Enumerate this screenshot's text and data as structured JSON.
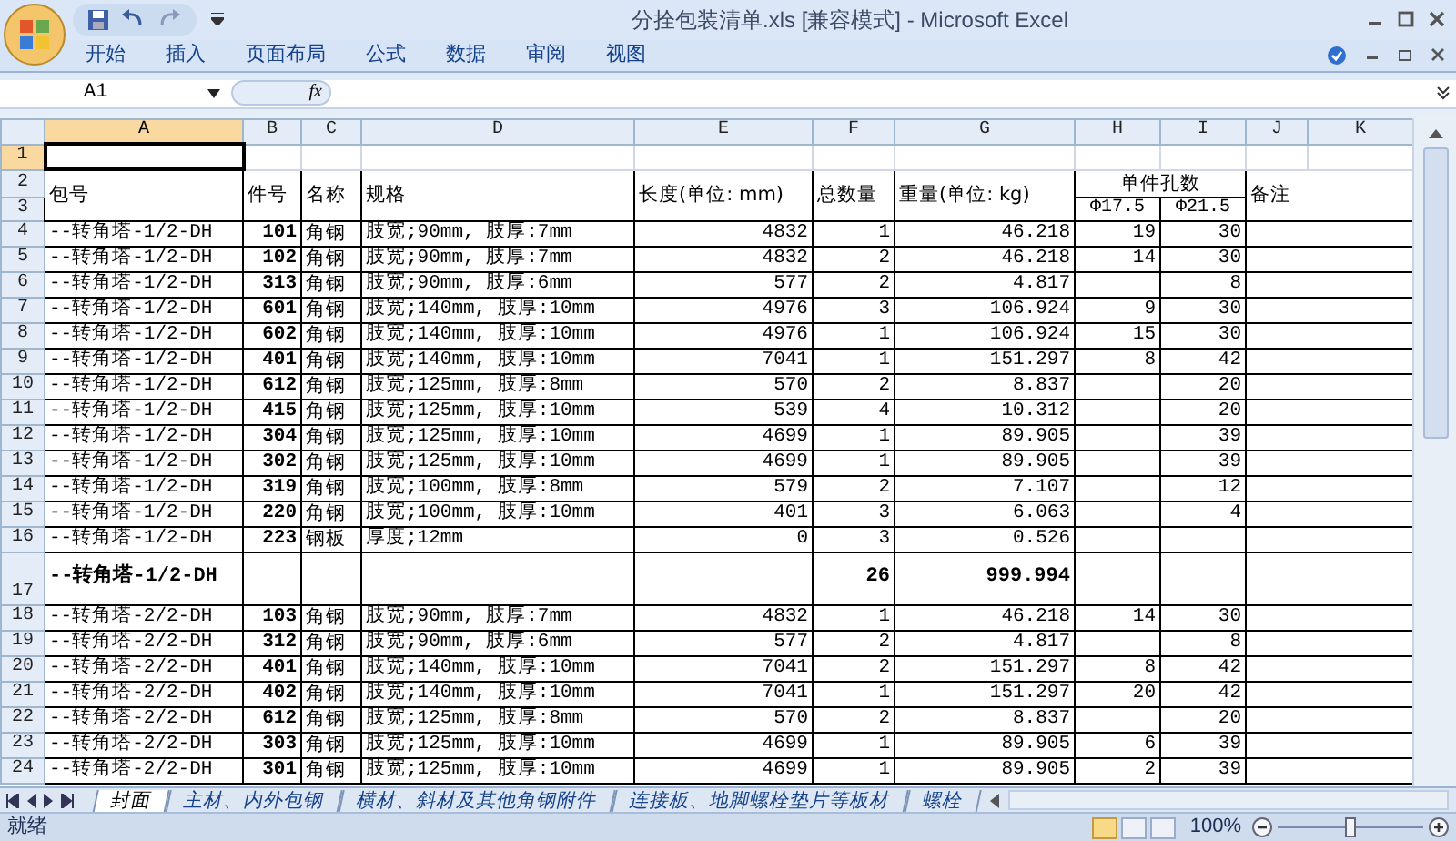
{
  "window": {
    "title": "分拴包装清单.xls  [兼容模式] - Microsoft Excel"
  },
  "ribbon_tabs": [
    {
      "label": "开始",
      "selected": false
    },
    {
      "label": "插入",
      "selected": false
    },
    {
      "label": "页面布局",
      "selected": false
    },
    {
      "label": "公式",
      "selected": false
    },
    {
      "label": "数据",
      "selected": false
    },
    {
      "label": "审阅",
      "selected": false
    },
    {
      "label": "视图",
      "selected": false
    }
  ],
  "formula_bar": {
    "name_box": "A1",
    "function_button": "fx"
  },
  "columns": [
    {
      "label": "A",
      "selected": true
    },
    {
      "label": "B",
      "selected": false
    },
    {
      "label": "C",
      "selected": false
    },
    {
      "label": "D",
      "selected": false
    },
    {
      "label": "E",
      "selected": false
    },
    {
      "label": "F",
      "selected": false
    },
    {
      "label": "G",
      "selected": false
    },
    {
      "label": "H",
      "selected": false
    },
    {
      "label": "I",
      "selected": false
    },
    {
      "label": "J",
      "selected": false
    },
    {
      "label": "K",
      "selected": false
    }
  ],
  "blank_row": {
    "number": "1",
    "selected": true
  },
  "header": {
    "numbers": [
      "2",
      "3"
    ],
    "package": "包号",
    "part_no": "件号",
    "name": "名称",
    "spec": "规格",
    "length": "长度(单位: mm)",
    "total_qty": "总数量",
    "weight": "重量(单位: kg)",
    "holes": "单件孔数",
    "holes_d17_5": "Φ17.5",
    "holes_d21_5": "Φ21.5",
    "remarks": "备注"
  },
  "rows": [
    {
      "kind": "data",
      "number": "4",
      "package": "--转角塔-1/2-DH",
      "part_no": "101",
      "name": "角钢",
      "spec": "肢宽;90mm, 肢厚:7mm",
      "length": "4832",
      "total_qty": "1",
      "weight": "46.218",
      "holes_d17_5": "19",
      "holes_d21_5": "30"
    },
    {
      "kind": "data",
      "number": "5",
      "package": "--转角塔-1/2-DH",
      "part_no": "102",
      "name": "角钢",
      "spec": "肢宽;90mm, 肢厚:7mm",
      "length": "4832",
      "total_qty": "2",
      "weight": "46.218",
      "holes_d17_5": "14",
      "holes_d21_5": "30"
    },
    {
      "kind": "data",
      "number": "6",
      "package": "--转角塔-1/2-DH",
      "part_no": "313",
      "name": "角钢",
      "spec": "肢宽;90mm, 肢厚:6mm",
      "length": "577",
      "total_qty": "2",
      "weight": "4.817",
      "holes_d21_5": "8"
    },
    {
      "kind": "data",
      "number": "7",
      "package": "--转角塔-1/2-DH",
      "part_no": "601",
      "name": "角钢",
      "spec": "肢宽;140mm, 肢厚:10mm",
      "length": "4976",
      "total_qty": "3",
      "weight": "106.924",
      "holes_d17_5": "9",
      "holes_d21_5": "30"
    },
    {
      "kind": "data",
      "number": "8",
      "package": "--转角塔-1/2-DH",
      "part_no": "602",
      "name": "角钢",
      "spec": "肢宽;140mm, 肢厚:10mm",
      "length": "4976",
      "total_qty": "1",
      "weight": "106.924",
      "holes_d17_5": "15",
      "holes_d21_5": "30"
    },
    {
      "kind": "data",
      "number": "9",
      "package": "--转角塔-1/2-DH",
      "part_no": "401",
      "name": "角钢",
      "spec": "肢宽;140mm, 肢厚:10mm",
      "length": "7041",
      "total_qty": "1",
      "weight": "151.297",
      "holes_d17_5": "8",
      "holes_d21_5": "42"
    },
    {
      "kind": "data",
      "number": "10",
      "package": "--转角塔-1/2-DH",
      "part_no": "612",
      "name": "角钢",
      "spec": "肢宽;125mm, 肢厚:8mm",
      "length": "570",
      "total_qty": "2",
      "weight": "8.837",
      "holes_d21_5": "20"
    },
    {
      "kind": "data",
      "number": "11",
      "package": "--转角塔-1/2-DH",
      "part_no": "415",
      "name": "角钢",
      "spec": "肢宽;125mm, 肢厚:10mm",
      "length": "539",
      "total_qty": "4",
      "weight": "10.312",
      "holes_d21_5": "20"
    },
    {
      "kind": "data",
      "number": "12",
      "package": "--转角塔-1/2-DH",
      "part_no": "304",
      "name": "角钢",
      "spec": "肢宽;125mm, 肢厚:10mm",
      "length": "4699",
      "total_qty": "1",
      "weight": "89.905",
      "holes_d21_5": "39"
    },
    {
      "kind": "data",
      "number": "13",
      "package": "--转角塔-1/2-DH",
      "part_no": "302",
      "name": "角钢",
      "spec": "肢宽;125mm, 肢厚:10mm",
      "length": "4699",
      "total_qty": "1",
      "weight": "89.905",
      "holes_d21_5": "39"
    },
    {
      "kind": "data",
      "number": "14",
      "package": "--转角塔-1/2-DH",
      "part_no": "319",
      "name": "角钢",
      "spec": "肢宽;100mm, 肢厚:8mm",
      "length": "579",
      "total_qty": "2",
      "weight": "7.107",
      "holes_d21_5": "12"
    },
    {
      "kind": "data",
      "number": "15",
      "package": "--转角塔-1/2-DH",
      "part_no": "220",
      "name": "角钢",
      "spec": "肢宽;100mm, 肢厚:10mm",
      "length": "401",
      "total_qty": "3",
      "weight": "6.063",
      "holes_d21_5": "4"
    },
    {
      "kind": "data",
      "number": "16",
      "package": "--转角塔-1/2-DH",
      "part_no": "223",
      "name": "钢板",
      "spec": "厚度;12mm",
      "length": "0",
      "total_qty": "3",
      "weight": "0.526"
    },
    {
      "kind": "subtotal",
      "number": "17",
      "package": "--转角塔-1/2-DH",
      "total_qty": "26",
      "weight": "999.994"
    },
    {
      "kind": "data",
      "number": "18",
      "package": "--转角塔-2/2-DH",
      "part_no": "103",
      "name": "角钢",
      "spec": "肢宽;90mm, 肢厚:7mm",
      "length": "4832",
      "total_qty": "1",
      "weight": "46.218",
      "holes_d17_5": "14",
      "holes_d21_5": "30"
    },
    {
      "kind": "data",
      "number": "19",
      "package": "--转角塔-2/2-DH",
      "part_no": "312",
      "name": "角钢",
      "spec": "肢宽;90mm, 肢厚:6mm",
      "length": "577",
      "total_qty": "2",
      "weight": "4.817",
      "holes_d21_5": "8"
    },
    {
      "kind": "data",
      "number": "20",
      "package": "--转角塔-2/2-DH",
      "part_no": "401",
      "name": "角钢",
      "spec": "肢宽;140mm, 肢厚:10mm",
      "length": "7041",
      "total_qty": "2",
      "weight": "151.297",
      "holes_d17_5": "8",
      "holes_d21_5": "42"
    },
    {
      "kind": "data",
      "number": "21",
      "package": "--转角塔-2/2-DH",
      "part_no": "402",
      "name": "角钢",
      "spec": "肢宽;140mm, 肢厚:10mm",
      "length": "7041",
      "total_qty": "1",
      "weight": "151.297",
      "holes_d17_5": "20",
      "holes_d21_5": "42"
    },
    {
      "kind": "data",
      "number": "22",
      "package": "--转角塔-2/2-DH",
      "part_no": "612",
      "name": "角钢",
      "spec": "肢宽;125mm, 肢厚:8mm",
      "length": "570",
      "total_qty": "2",
      "weight": "8.837",
      "holes_d21_5": "20"
    },
    {
      "kind": "data",
      "number": "23",
      "package": "--转角塔-2/2-DH",
      "part_no": "303",
      "name": "角钢",
      "spec": "肢宽;125mm, 肢厚:10mm",
      "length": "4699",
      "total_qty": "1",
      "weight": "89.905",
      "holes_d17_5": "6",
      "holes_d21_5": "39"
    },
    {
      "kind": "data",
      "number": "24",
      "package": "--转角塔-2/2-DH",
      "part_no": "301",
      "name": "角钢",
      "spec": "肢宽;125mm, 肢厚:10mm",
      "length": "4699",
      "total_qty": "1",
      "weight": "89.905",
      "holes_d17_5": "2",
      "holes_d21_5": "39"
    }
  ],
  "sheet_tabs": [
    {
      "label": "封面",
      "selected": true
    },
    {
      "label": "主材、内外包钢",
      "selected": false
    },
    {
      "label": "横材、斜材及其他角钢附件",
      "selected": false
    },
    {
      "label": "连接板、地脚螺栓垫片等板材",
      "selected": false
    },
    {
      "label": "螺栓",
      "selected": false
    }
  ],
  "status_bar": {
    "status": "就绪",
    "zoom": "100%",
    "zoom_slider": {
      "level": 0.5
    }
  }
}
